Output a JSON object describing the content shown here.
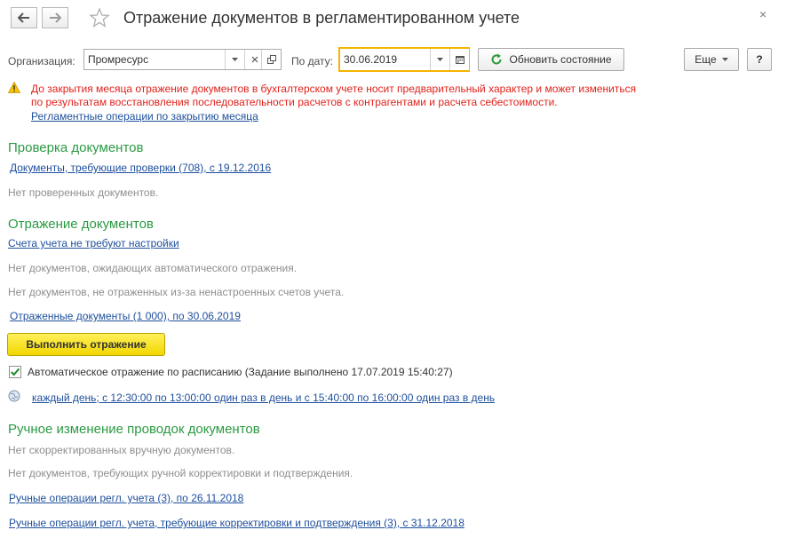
{
  "header": {
    "title": "Отражение документов в регламентированном учете",
    "close_glyph": "×"
  },
  "toolbar": {
    "org_label": "Организация:",
    "org_value": "Промресурс",
    "date_label": "По дату:",
    "date_value": "30.06.2019",
    "refresh_label": "Обновить состояние",
    "more_label": "Еще",
    "help_label": "?"
  },
  "warning": {
    "line1": "До закрытия месяца отражение документов в бухгалтерском учете носит предварительный характер и может измениться",
    "line2": "по результатам восстановления последовательности расчетов с контрагентами и расчета себестоимости.",
    "link": "Регламентные операции по закрытию месяца"
  },
  "check": {
    "heading": "Проверка документов",
    "link": "Документы, требующие проверки (708), с 19.12.2016",
    "note": "Нет проверенных документов."
  },
  "reflect": {
    "heading": "Отражение документов",
    "accounts_link": "Счета учета не требуют настройки",
    "note1": "Нет документов, ожидающих автоматического отражения.",
    "note2": "Нет документов, не отраженных из-за ненастроенных счетов учета.",
    "reflected_link": "Отраженные документы (1 000), по 30.06.2019",
    "execute_button": "Выполнить отражение",
    "auto_checkbox_checked": true,
    "auto_label": "Автоматическое отражение по расписанию (Задание выполнено 17.07.2019 15:40:27)",
    "schedule_link": "каждый день; с 12:30:00 по 13:00:00 один раз в день и с 15:40:00 по 16:00:00 один раз в день"
  },
  "manual": {
    "heading": "Ручное изменение проводок документов",
    "note1": "Нет скорректированных вручную документов.",
    "note2": "Нет документов, требующих ручной корректировки и подтверждения.",
    "link1": "Ручные операции регл. учета (3), по 26.11.2018",
    "link2": "Ручные операции регл. учета, требующие корректировки и подтверждения (3), с 31.12.2018"
  },
  "colors": {
    "section_heading": "#2b9a43",
    "warning_text": "#e0221b",
    "link": "#1e4f9c",
    "date_field_border": "#f5b400",
    "primary_button": "#f2d600"
  },
  "icons": {
    "back": "arrow-left-icon",
    "forward": "arrow-right-icon",
    "favorite": "star-icon",
    "refresh": "refresh-icon",
    "warning": "warning-icon",
    "schedule": "globe-icon"
  }
}
